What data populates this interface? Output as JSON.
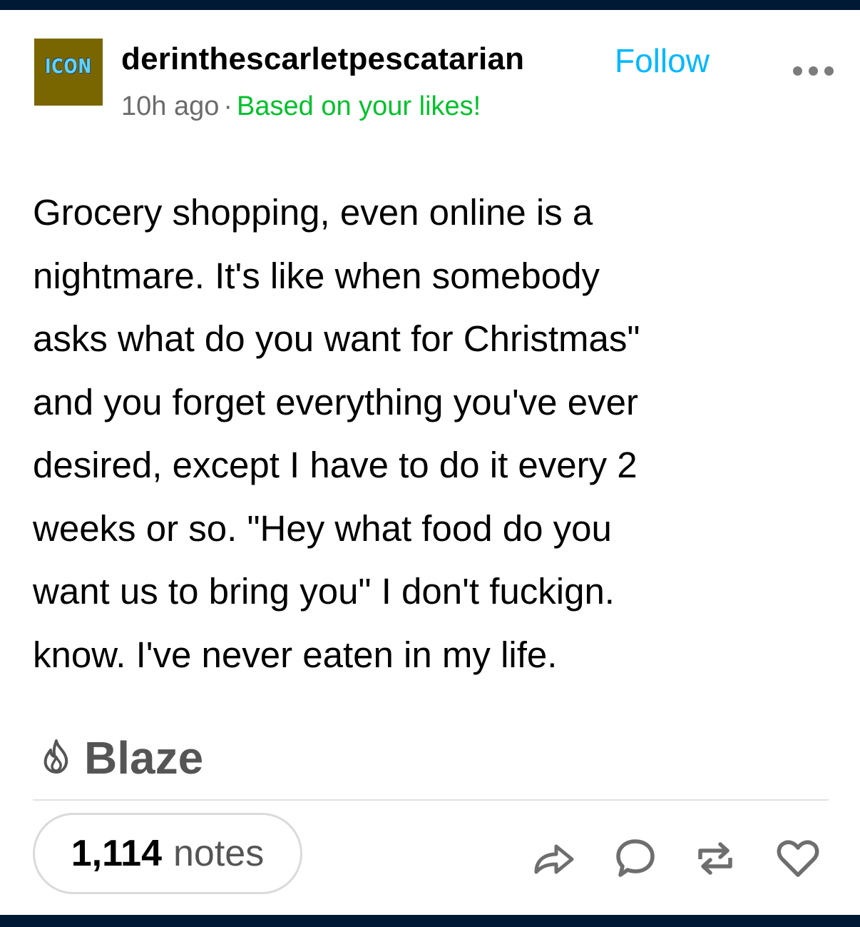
{
  "post": {
    "avatar_text": "ICON",
    "username": "derinthescarletpescatarian",
    "follow_label": "Follow",
    "timestamp": "10h ago",
    "separator": "·",
    "recommendation": "Based on your likes!",
    "body_lines": [
      "Grocery shopping, even online is a",
      "nightmare. It's like when somebody",
      "asks what do you want for Christmas\"",
      "and you forget everything you've ever",
      "desired, except I have to do it every 2",
      "weeks or so. \"Hey what food do you",
      "want us to bring you\" I don't fuckign.",
      "know. I've never eaten in my life."
    ],
    "blaze_label": "Blaze",
    "blaze_icon": "flame-icon"
  },
  "footer": {
    "notes_count": "1,114",
    "notes_label": "notes",
    "actions": [
      "share-icon",
      "reply-icon",
      "reblog-icon",
      "like-icon"
    ]
  },
  "colors": {
    "frame": "#001935",
    "avatar_bg": "#7a6600",
    "avatar_text": "#5fd3ff",
    "follow": "#00b8ff",
    "recommendation": "#00c12b",
    "meta": "#6b6b6b",
    "icon_gray": "#6e6e6e"
  }
}
